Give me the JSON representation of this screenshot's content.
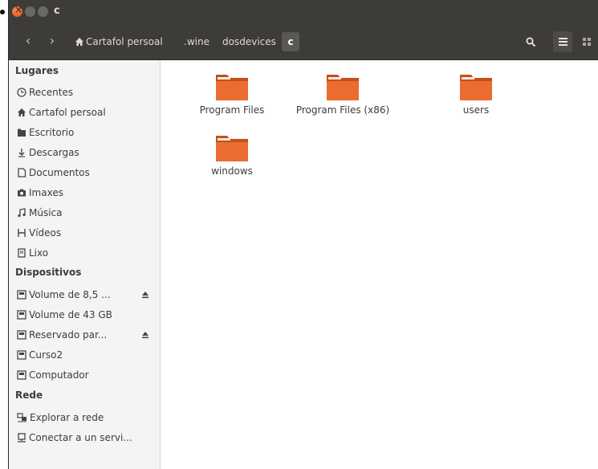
{
  "window": {
    "title": "c"
  },
  "breadcrumb": {
    "items": [
      "Cartafol persoal",
      ".wine",
      "dosdevices",
      "c"
    ]
  },
  "sidebar": {
    "places_header": "Lugares",
    "places": [
      "Recentes",
      "Cartafol persoal",
      "Escritorio",
      "Descargas",
      "Documentos",
      "Imaxes",
      "Música",
      "Vídeos",
      "Lixo"
    ],
    "devices_header": "Dispositivos",
    "devices": [
      "Volume de 8,5 ...",
      "Volume de 43 GB",
      "Reservado par...",
      "Curso2",
      "Computador"
    ],
    "network_header": "Rede",
    "network": [
      "Explorar a rede",
      "Conectar a un servi..."
    ]
  },
  "files": [
    "Program Files",
    "Program Files (x86)",
    "users",
    "windows"
  ],
  "colors": {
    "folder": "#e86a2c",
    "titlebar": "#3d3c38",
    "close": "#e5582a"
  }
}
